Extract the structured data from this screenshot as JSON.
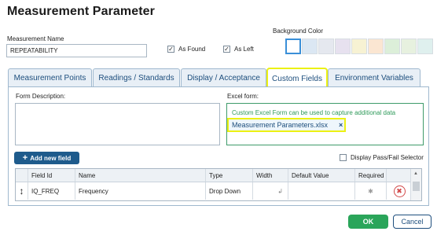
{
  "dialog": {
    "title": "Measurement Parameter"
  },
  "form": {
    "measurement_name_label": "Measurement Name",
    "measurement_name_value": "REPEATABILITY",
    "as_found_label": "As Found",
    "as_left_label": "As Left",
    "as_found_checked": "✓",
    "as_left_checked": "✓",
    "background_color_label": "Background Color",
    "swatches": [
      "#ffffff",
      "#dbe7f3",
      "#e5e8ef",
      "#e7e1ef",
      "#f7f2d3",
      "#fbe6d2",
      "#dcefd9",
      "#e7f1df",
      "#dff0ee"
    ]
  },
  "tabs": [
    {
      "label": "Measurement Points"
    },
    {
      "label": "Readings / Standards"
    },
    {
      "label": "Display / Acceptance"
    },
    {
      "label": "Custom Fields"
    },
    {
      "label": "Environment Variables"
    }
  ],
  "custom_fields": {
    "form_description_label": "Form Description:",
    "excel_form_label": "Excel form:",
    "excel_hint": "Custom Excel Form can be used to capture additional data",
    "excel_file": "Measurement Parameters.xlsx",
    "remove_icon": "×",
    "add_button": "Add new field",
    "add_icon": "+",
    "display_pass_fail": "Display Pass/Fail Selector"
  },
  "grid": {
    "columns": [
      "",
      "Field Id",
      "Name",
      "Type",
      "Width",
      "Default Value",
      "Required",
      ""
    ],
    "rows": [
      {
        "drag_icon": "↕",
        "field_id": "IQ_FREQ",
        "name": "Frequency",
        "type": "Drop Down",
        "width_icon": "↲",
        "default_value": "",
        "required_icon": "✱",
        "delete_icon": "✖"
      }
    ]
  },
  "footer": {
    "ok": "OK",
    "cancel": "Cancel"
  }
}
